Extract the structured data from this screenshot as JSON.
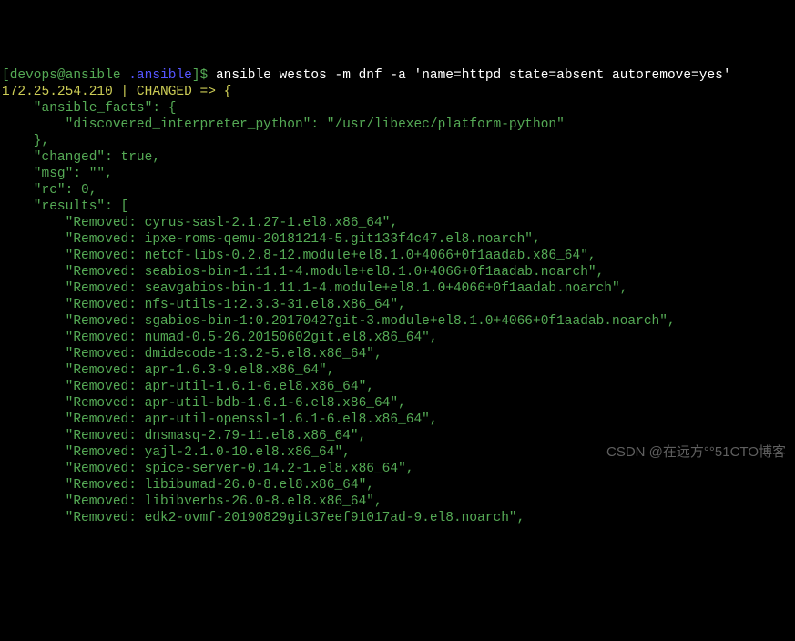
{
  "prompt": {
    "user_host": "[devops@ansible ",
    "cwd": ".ansible",
    "suffix": "]$ ",
    "command": "ansible westos -m dnf -a 'name=httpd state=absent autoremove=yes'"
  },
  "header_line": "172.25.254.210 | CHANGED => {",
  "lines": [
    "    \"ansible_facts\": {",
    "        \"discovered_interpreter_python\": \"/usr/libexec/platform-python\"",
    "    },",
    "    \"changed\": true,",
    "    \"msg\": \"\",",
    "    \"rc\": 0,",
    "    \"results\": ["
  ],
  "results": [
    "        \"Removed: cyrus-sasl-2.1.27-1.el8.x86_64\",",
    "        \"Removed: ipxe-roms-qemu-20181214-5.git133f4c47.el8.noarch\",",
    "        \"Removed: netcf-libs-0.2.8-12.module+el8.1.0+4066+0f1aadab.x86_64\",",
    "        \"Removed: seabios-bin-1.11.1-4.module+el8.1.0+4066+0f1aadab.noarch\",",
    "        \"Removed: seavgabios-bin-1.11.1-4.module+el8.1.0+4066+0f1aadab.noarch\",",
    "        \"Removed: nfs-utils-1:2.3.3-31.el8.x86_64\",",
    "        \"Removed: sgabios-bin-1:0.20170427git-3.module+el8.1.0+4066+0f1aadab.noarch\",",
    "        \"Removed: numad-0.5-26.20150602git.el8.x86_64\",",
    "        \"Removed: dmidecode-1:3.2-5.el8.x86_64\",",
    "        \"Removed: apr-1.6.3-9.el8.x86_64\",",
    "        \"Removed: apr-util-1.6.1-6.el8.x86_64\",",
    "        \"Removed: apr-util-bdb-1.6.1-6.el8.x86_64\",",
    "        \"Removed: apr-util-openssl-1.6.1-6.el8.x86_64\",",
    "        \"Removed: dnsmasq-2.79-11.el8.x86_64\",",
    "        \"Removed: yajl-2.1.0-10.el8.x86_64\",",
    "        \"Removed: spice-server-0.14.2-1.el8.x86_64\",",
    "        \"Removed: libibumad-26.0-8.el8.x86_64\",",
    "        \"Removed: libibverbs-26.0-8.el8.x86_64\",",
    "        \"Removed: edk2-ovmf-20190829git37eef91017ad-9.el8.noarch\","
  ],
  "watermark": "CSDN @在远方°°51CTO博客"
}
